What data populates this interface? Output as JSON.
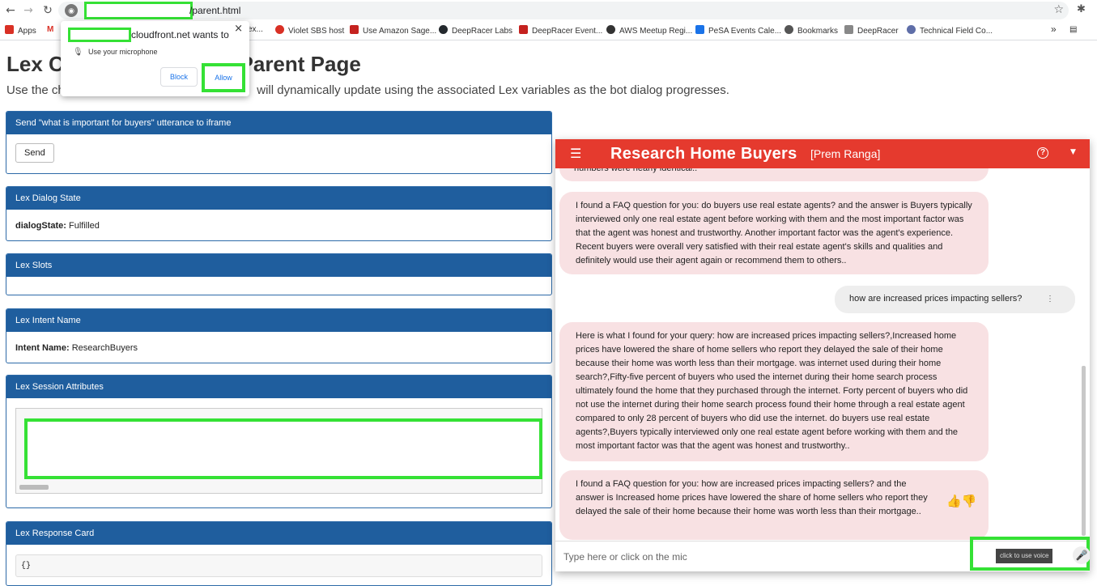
{
  "browser": {
    "url_path": "/parent.html",
    "nav": {
      "back": "←",
      "forward": "→",
      "reload": "↻"
    },
    "bookmarks": [
      {
        "label": "Apps",
        "color": "#d93025"
      },
      {
        "label": "M",
        "color": "#d93025"
      },
      {
        "label": "ex...",
        "color": "#888888"
      },
      {
        "label": "Violet SBS host",
        "color": "#d93025"
      },
      {
        "label": "Use Amazon Sage...",
        "color": "#c5221f"
      },
      {
        "label": "DeepRacer Labs",
        "color": "#24292e"
      },
      {
        "label": "DeepRacer Event...",
        "color": "#c5221f"
      },
      {
        "label": "AWS Meetup Regi...",
        "color": "#333333"
      },
      {
        "label": "PeSA Events Cale...",
        "color": "#1a73e8"
      },
      {
        "label": "Bookmarks",
        "color": "#555555"
      },
      {
        "label": "DeepRacer",
        "color": "#777777"
      },
      {
        "label": "Technical Field Co...",
        "color": "#5f6ea8"
      }
    ],
    "bookmarks_more": "»"
  },
  "permission_popup": {
    "host_suffix": "cloudfront.net wants to",
    "request": "Use your microphone",
    "block_label": "Block",
    "allow_label": "Allow",
    "close": "×"
  },
  "page": {
    "title": "Lex C                              Parent Page",
    "description": "Use the ch                                                  ,      will dynamically update using the associated Lex variables as the bot dialog progresses."
  },
  "panels": {
    "send": {
      "header": "Send \"what is important for buyers\" utterance to iframe",
      "button": "Send"
    },
    "dialog_state": {
      "header": "Lex Dialog State",
      "key": "dialogState:",
      "value": "Fulfilled"
    },
    "slots": {
      "header": "Lex Slots"
    },
    "intent": {
      "header": "Lex Intent Name",
      "key": "Intent Name:",
      "value": "ResearchBuyers"
    },
    "session": {
      "header": "Lex Session Attributes"
    },
    "response_card": {
      "header": "Lex Response Card",
      "value": "{}"
    }
  },
  "chatbot": {
    "title": "Research Home Buyers",
    "subtitle": "[Prem Ranga]",
    "header_color": "#e53a2e",
    "messages": [
      {
        "from": "bot",
        "text": "numbers were nearly identical.."
      },
      {
        "from": "bot",
        "text": "I found a FAQ question for you: do buyers use real estate agents? and the answer is Buyers typically interviewed only one real estate agent before working with them and the most important factor was that the agent was honest and trustworthy. Another important factor was the agent's experience. Recent buyers were overall very satisfied with their real estate agent's skills and qualities and definitely would use their agent again or recommend them to others.."
      },
      {
        "from": "user",
        "text": "how are increased prices impacting sellers?"
      },
      {
        "from": "bot",
        "text": "Here is what I found for your query: how are increased prices impacting sellers?,Increased home prices have lowered the share of home sellers who report they delayed the sale of their home because their home was worth less than their mortgage. was internet used during their home search?,Fifty-five percent of buyers who used the internet during their home search process ultimately found the home that they purchased through the internet. Forty percent of buyers who did not use the internet during their home search process found their home through a real estate agent compared to only 28 percent of buyers who did use the internet. do buyers use real estate agents?,Buyers typically interviewed only one real estate agent before working with them and the most important factor was that the agent was honest and trustworthy.."
      },
      {
        "from": "bot",
        "text": "I found a FAQ question for you: how are increased prices impacting sellers? and the answer is Increased home prices have lowered the share of home sellers who report they delayed the sale of their home because their home was worth less than their mortgage.."
      }
    ],
    "input_placeholder": "Type here or click on the mic",
    "voice_tooltip": "click to use voice"
  }
}
